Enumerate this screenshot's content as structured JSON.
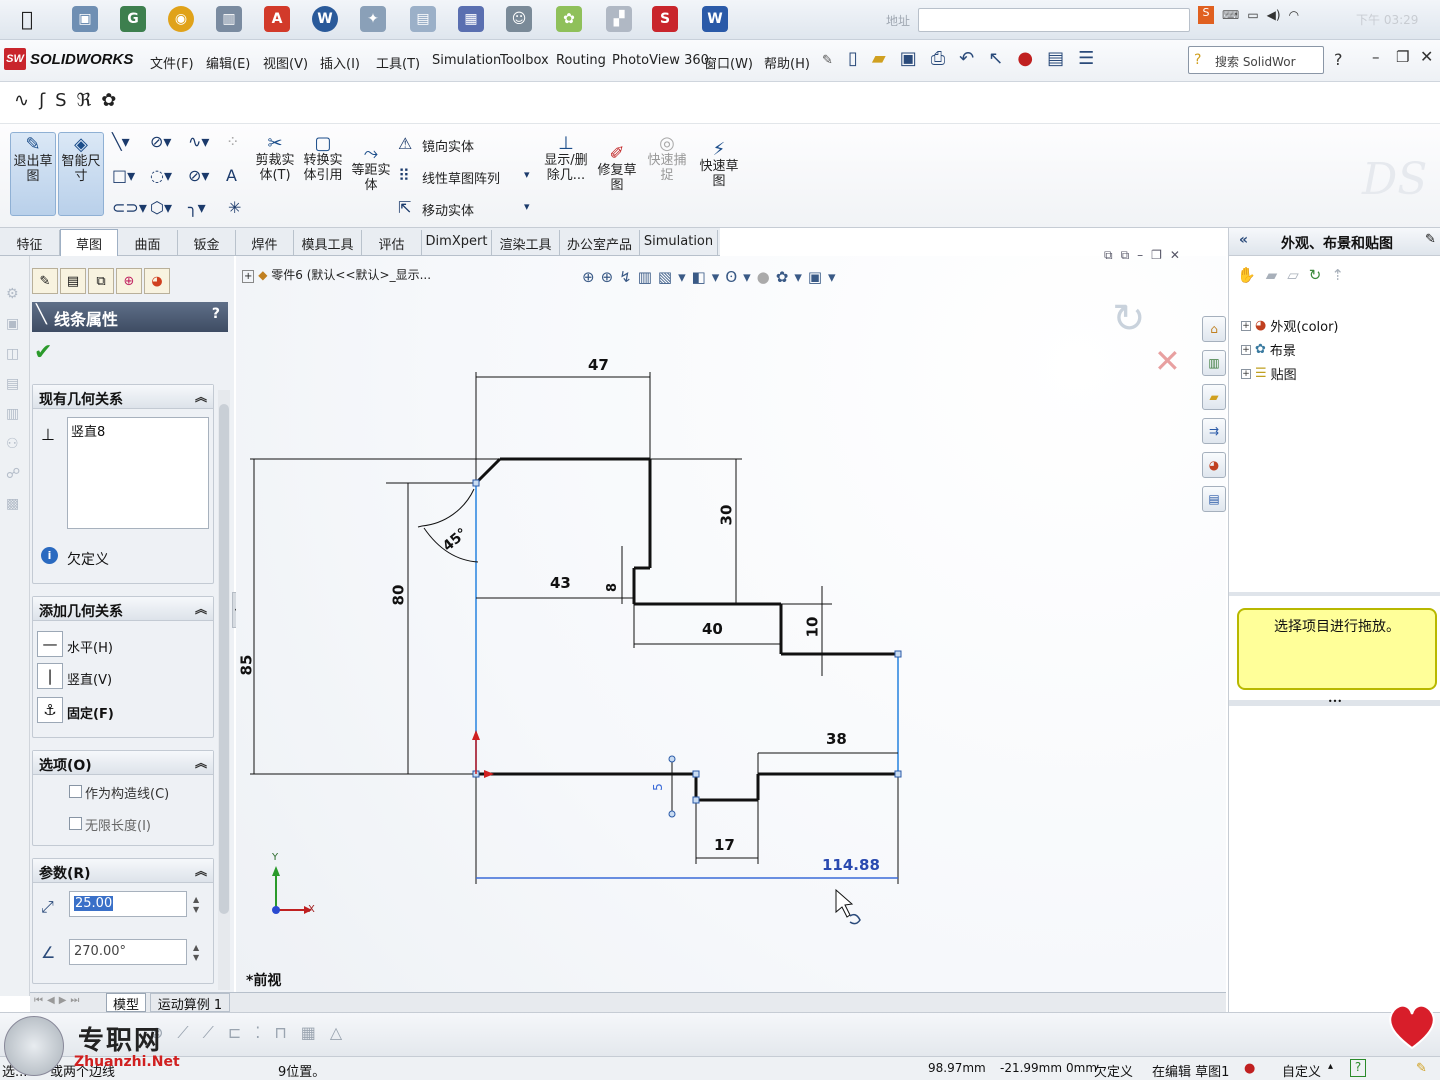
{
  "taskbar": {
    "address_label": "地址",
    "address_value": "",
    "clock": "下午 03:29"
  },
  "menubar": {
    "logo": "SOLIDWORKS",
    "logo_mark": "SW",
    "items": [
      "文件(F)",
      "编辑(E)",
      "视图(V)",
      "插入(I)",
      "工具(T)",
      "Simulation",
      "Toolbox",
      "Routing",
      "PhotoView 360",
      "窗口(W)",
      "帮助(H)"
    ],
    "search_placeholder": "搜索 SolidWor"
  },
  "commandmanager": {
    "exit_sketch": "退出草图",
    "smart_dim": "智能尺寸",
    "trim": "剪裁实体(T)",
    "convert": "转换实体引用",
    "offset": "等距实体",
    "mirror": "镜向实体",
    "linear_pattern": "线性草图阵列",
    "move": "移动实体",
    "show_relations": "显示/删除几...",
    "repair": "修复草图",
    "quick_snap": "快速捕捉",
    "rapid_sketch": "快速草图"
  },
  "tabs": [
    "特征",
    "草图",
    "曲面",
    "钣金",
    "焊件",
    "模具工具",
    "评估",
    "DimXpert",
    "渲染工具",
    "办公室产品",
    "Simulation"
  ],
  "property_manager": {
    "title": "线条属性",
    "help": "?",
    "existing_relations": {
      "header": "现有几何关系",
      "items": [
        "竖直8"
      ],
      "status": "欠定义"
    },
    "add_relations": {
      "header": "添加几何关系",
      "horizontal": "水平(H)",
      "vertical": "竖直(V)",
      "fix": "固定(F)"
    },
    "options": {
      "header": "选项(O)",
      "construction": "作为构造线(C)",
      "infinite": "无限长度(I)"
    },
    "parameters": {
      "header": "参数(R)",
      "length": "25.00",
      "angle": "270.00°"
    }
  },
  "graphics": {
    "feature_path": "零件6 (默认<<默认>_显示...",
    "view_label": "*前视",
    "dims": {
      "d47": "47",
      "d30": "30",
      "d8": "8",
      "d43": "43",
      "d40": "40",
      "d10": "10",
      "d80": "80",
      "d85": "85",
      "d45": "45°",
      "d38": "38",
      "d5": "5",
      "d17": "17",
      "d114": "114.88"
    },
    "axis_x": "X",
    "axis_y": "Y"
  },
  "bottomtabs": {
    "model": "模型",
    "motion": "运动算例 1"
  },
  "taskpane": {
    "title": "外观、布景和贴图",
    "items": [
      "外观(color)",
      "布景",
      "贴图"
    ],
    "tooltip": "选择项目进行拖放。"
  },
  "statusbar": {
    "left": "选...",
    "left2": "或两个边线",
    "left3": "9位置。",
    "x": "98.97mm",
    "y": "-21.99mm",
    "z": "0mm",
    "state": "欠定义",
    "editing": "在编辑 草图1",
    "custom": "自定义",
    "help": "?"
  },
  "watermark": {
    "site": "专职网",
    "url": "Zhuanzhi.Net"
  },
  "colors": {
    "sketch_line": "#111111",
    "selected_line": "#5aa0e6",
    "dimension": "#111111",
    "accent_red": "#c9252c",
    "tooltip_bg": "#ffff99"
  }
}
